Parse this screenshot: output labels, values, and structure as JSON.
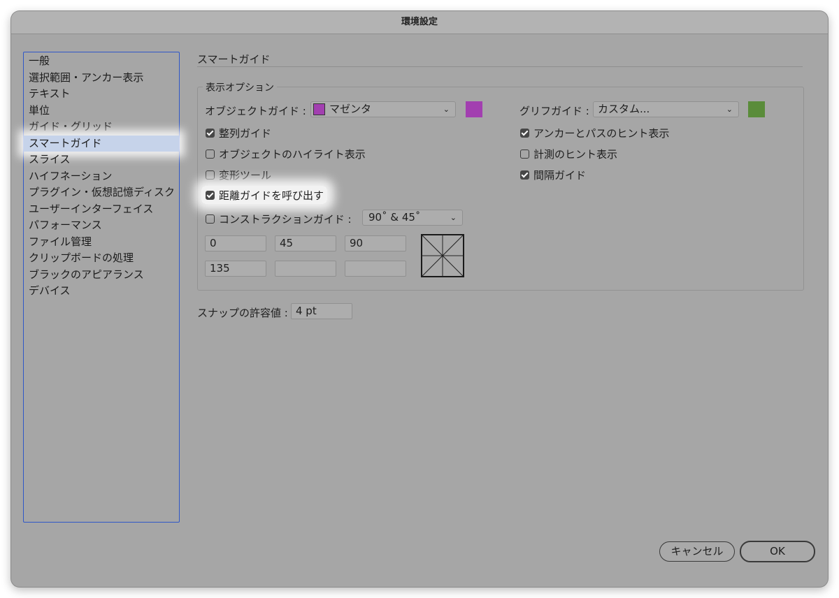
{
  "title": "環境設定",
  "sidebar": {
    "items": [
      "一般",
      "選択範囲・アンカー表示",
      "テキスト",
      "単位",
      "ガイド・グリッド",
      "スマートガイド",
      "スライス",
      "ハイフネーション",
      "プラグイン・仮想記憶ディスク",
      "ユーザーインターフェイス",
      "パフォーマンス",
      "ファイル管理",
      "クリップボードの処理",
      "ブラックのアピアランス",
      "デバイス"
    ],
    "selected": "スマートガイド"
  },
  "section_title": "スマートガイド",
  "display_options": {
    "legend": "表示オプション",
    "object_guide_label": "オブジェクトガイド :",
    "object_guide_value": "マゼンタ",
    "object_guide_color": "#a23fb0",
    "glyph_guide_label": "グリフガイド :",
    "glyph_guide_value": "カスタム...",
    "glyph_guide_color": "#5a8c3a",
    "checkboxes_left": [
      {
        "label": "整列ガイド",
        "checked": true
      },
      {
        "label": "オブジェクトのハイライト表示",
        "checked": false
      },
      {
        "label": "変形ツール",
        "checked": false
      },
      {
        "label": "距離ガイドを呼び出す",
        "checked": true
      }
    ],
    "checkboxes_right": [
      {
        "label": "アンカーとパスのヒント表示",
        "checked": true
      },
      {
        "label": "計測のヒント表示",
        "checked": false
      },
      {
        "label": "間隔ガイド",
        "checked": true
      }
    ],
    "construction": {
      "label": "コンストラクションガイド :",
      "checked": false,
      "value": "90˚ & 45˚",
      "angles": [
        "0",
        "45",
        "90",
        "135",
        "",
        ""
      ]
    }
  },
  "snap": {
    "label": "スナップの許容値 :",
    "value": "4 pt"
  },
  "buttons": {
    "cancel": "キャンセル",
    "ok": "OK"
  }
}
